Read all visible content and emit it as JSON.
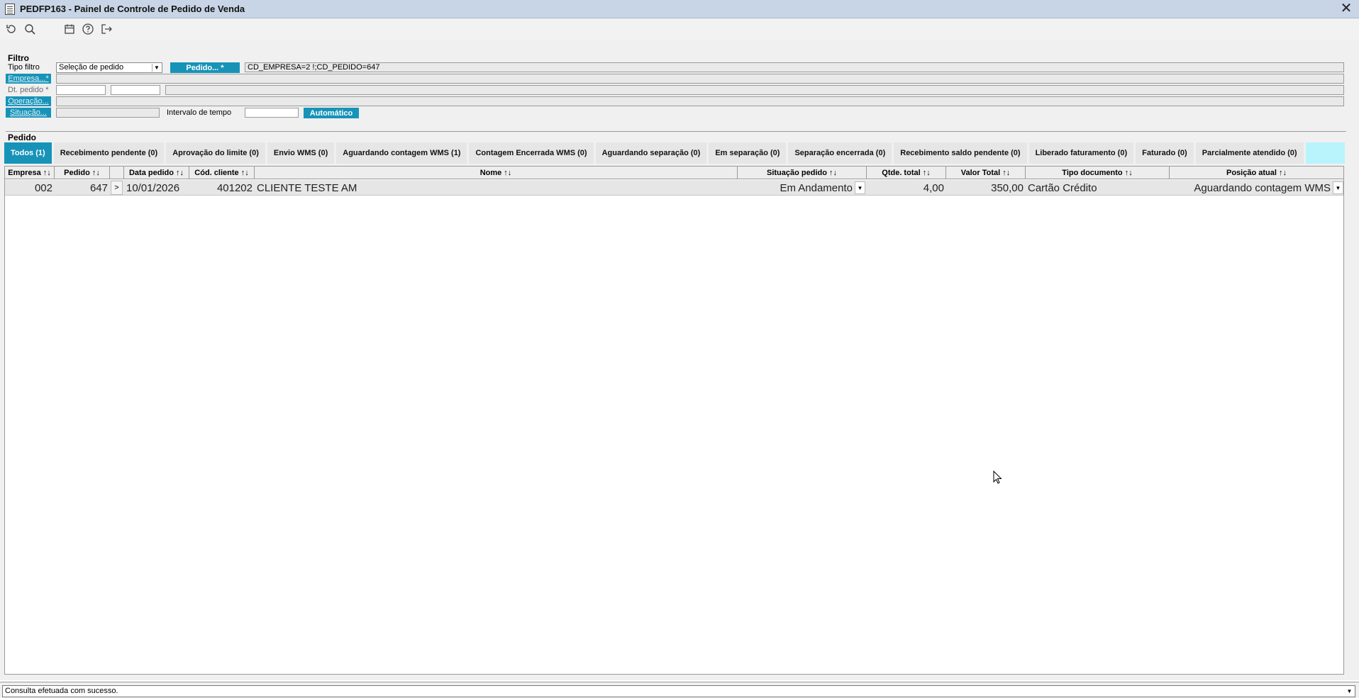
{
  "window": {
    "title": "PEDFP163 - Painel de Controle de Pedido de Venda",
    "close_glyph": "✕"
  },
  "toolbar": {
    "icons": [
      "refresh-icon",
      "search-icon",
      "calendar-icon",
      "help-icon",
      "exit-icon"
    ]
  },
  "filter": {
    "section_title": "Filtro",
    "tipo_filtro_label": "Tipo filtro",
    "tipo_filtro_value": "Seleção de pedido",
    "pedido_button": "Pedido... *",
    "pedido_value": "CD_EMPRESA=2 !;CD_PEDIDO=647",
    "empresa_button": "Empresa...*",
    "dt_pedido_label": "Dt. pedido *",
    "dt_pedido_from": "",
    "dt_pedido_to": "",
    "operacao_button": "Operação...",
    "situacao_button": "Situação...",
    "intervalo_label": "Intervalo de tempo",
    "intervalo_value": "",
    "automatico_button": "Automático"
  },
  "pedido_section": {
    "title": "Pedido",
    "tabs": [
      {
        "label": "Todos (1)",
        "active": true
      },
      {
        "label": "Recebimento pendente (0)"
      },
      {
        "label": "Aprovação do limite (0)"
      },
      {
        "label": "Envio WMS (0)"
      },
      {
        "label": "Aguardando contagem WMS (1)"
      },
      {
        "label": "Contagem Encerrada WMS (0)"
      },
      {
        "label": "Aguardando separação (0)"
      },
      {
        "label": "Em separação (0)"
      },
      {
        "label": "Separação encerrada (0)"
      },
      {
        "label": "Recebimento saldo pendente (0)"
      },
      {
        "label": "Liberado faturamento (0)"
      },
      {
        "label": "Faturado (0)"
      },
      {
        "label": "Parcialmente atendido (0)"
      }
    ]
  },
  "grid": {
    "columns": [
      "Empresa ↑↓",
      "Pedido ↑↓",
      "",
      "Data pedido ↑↓",
      "Cód. cliente ↑↓",
      "Nome ↑↓",
      "Situação pedido ↑↓",
      "Qtde. total ↑↓",
      "Valor Total ↑↓",
      "Tipo documento ↑↓",
      "Posição atual ↑↓"
    ],
    "rows": [
      {
        "empresa": "002",
        "pedido": "647",
        "expand": ">",
        "data_pedido": "10/01/2026",
        "cod_cliente": "401202",
        "nome": "CLIENTE TESTE AM",
        "situacao": "Em Andamento",
        "qtde_total": "4,00",
        "valor_total": "350,00",
        "tipo_documento": "Cartão Crédito",
        "posicao_atual": "Aguardando contagem WMS"
      }
    ]
  },
  "status": {
    "message": "Consulta efetuada com sucesso."
  }
}
